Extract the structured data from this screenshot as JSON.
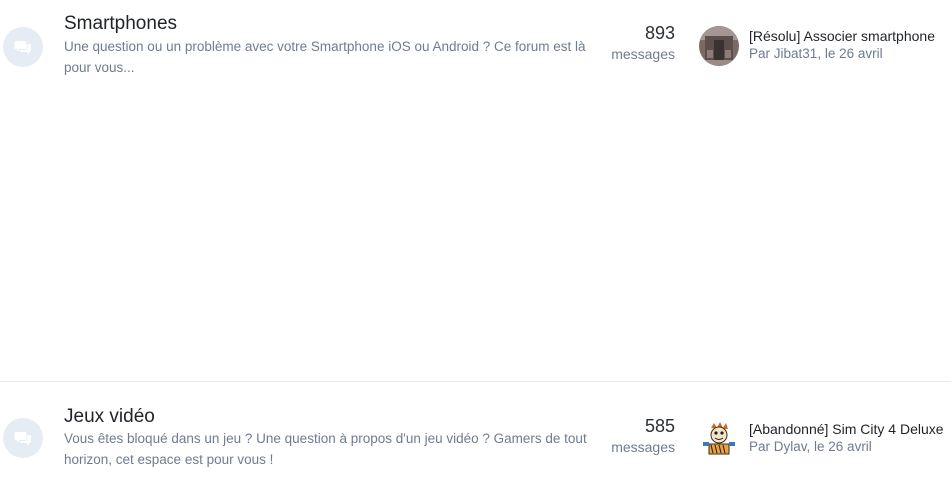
{
  "forums": [
    {
      "title": "Smartphones",
      "description": "Une question ou un problème avec votre Smartphone iOS ou Android ? Ce forum est là pour vous...",
      "icon": "chat-bubbles-icon",
      "message_count": "893",
      "message_label": "messages",
      "last_post": {
        "title": "[Résolu] Associer smartphone",
        "by_prefix": "Par ",
        "author": "Jibat31",
        "date": ", le 26 avril"
      }
    },
    {
      "title": "Jeux vidéo",
      "description": "Vous êtes bloqué dans un jeu ? Une question à propos d'un jeu vidéo ? Gamers de tout horizon, cet espace est pour vous !",
      "icon": "chat-bubbles-icon",
      "message_count": "585",
      "message_label": "messages",
      "last_post": {
        "title": "[Abandonné] Sim City 4 Deluxe",
        "by_prefix": "Par ",
        "author": "Dylav",
        "date": ", le 26 avril"
      }
    }
  ],
  "colors": {
    "icon_bg": "#e6ecf3",
    "icon_fg": "#ffffff",
    "muted_text": "#6f7c90",
    "main_text": "#1f2328"
  }
}
